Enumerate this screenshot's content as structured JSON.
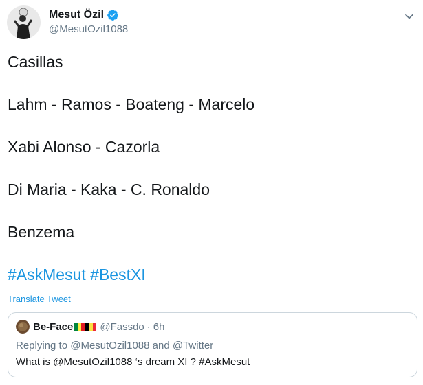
{
  "tweet": {
    "author_name": "Mesut Özil",
    "author_handle": "@MesutOzil1088",
    "lines": [
      "Casillas",
      "Lahm - Ramos - Boateng - Marcelo",
      "Xabi Alonso - Cazorla",
      "Di Maria - Kaka - C. Ronaldo",
      "Benzema"
    ],
    "hashtags": [
      "#AskMesut",
      "#BestXI"
    ],
    "translate_label": "Translate Tweet"
  },
  "quoted": {
    "author_name": "Be-Face",
    "author_handle": "@Fassdo",
    "separator": "·",
    "time": "6h",
    "reply_prefix": "Replying to",
    "reply_mention_1": "@MesutOzil1088",
    "reply_and": "and",
    "reply_mention_2": "@Twitter",
    "text": "What is @MesutOzil1088 ‘s dream XI ? #AskMesut"
  },
  "colors": {
    "link": "#1b95e0",
    "secondary_text": "#657786",
    "border": "#ccd6dd",
    "verified": "#1da1f2"
  },
  "icons": {
    "verified": "verified-badge-icon",
    "more": "chevron-down-icon"
  }
}
